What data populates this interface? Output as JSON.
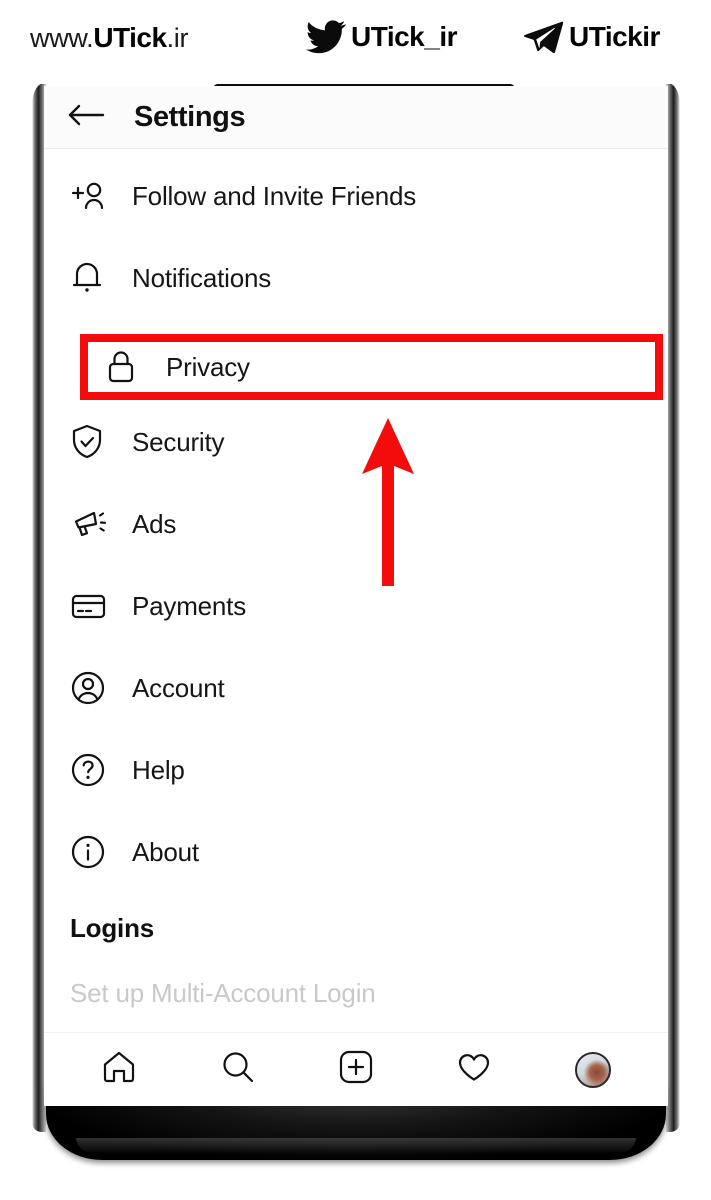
{
  "watermark": {
    "items": [
      {
        "icon": "none",
        "prefix": "www.",
        "name": "UTick",
        "suffix": ".ir",
        "full": "www.UTick.ir"
      },
      {
        "icon": "twitter-bird-icon",
        "name": "UTick_ir",
        "full": "UTick_ir"
      },
      {
        "icon": "telegram-plane-icon",
        "name": "UTickir",
        "full": "UTickir"
      }
    ]
  },
  "app": {
    "header": {
      "back_icon": "back-arrow-icon",
      "title": "Settings"
    },
    "settings_items": [
      {
        "icon": "person-plus-icon",
        "label": "Follow and Invite Friends",
        "highlighted": false
      },
      {
        "icon": "bell-icon",
        "label": "Notifications",
        "highlighted": false
      },
      {
        "icon": "lock-icon",
        "label": "Privacy",
        "highlighted": true
      },
      {
        "icon": "shield-check-icon",
        "label": "Security",
        "highlighted": false
      },
      {
        "icon": "megaphone-icon",
        "label": "Ads",
        "highlighted": false
      },
      {
        "icon": "credit-card-icon",
        "label": "Payments",
        "highlighted": false
      },
      {
        "icon": "user-circle-icon",
        "label": "Account",
        "highlighted": false
      },
      {
        "icon": "question-circle-icon",
        "label": "Help",
        "highlighted": false
      },
      {
        "icon": "info-circle-icon",
        "label": "About",
        "highlighted": false
      }
    ],
    "logins_section": {
      "header": "Logins",
      "disabled_item": "Set up Multi-Account Login"
    },
    "bottom_nav": [
      {
        "icon": "home-icon",
        "label": "Home"
      },
      {
        "icon": "search-icon",
        "label": "Search"
      },
      {
        "icon": "add-post-icon",
        "label": "Create"
      },
      {
        "icon": "heart-icon",
        "label": "Activity"
      },
      {
        "icon": "profile-avatar",
        "label": "Profile"
      }
    ]
  },
  "annotation": {
    "highlight_color": "#f40c0c",
    "arrow_color": "#f40c0c",
    "arrow_direction": "up",
    "arrow_target": "Privacy"
  }
}
